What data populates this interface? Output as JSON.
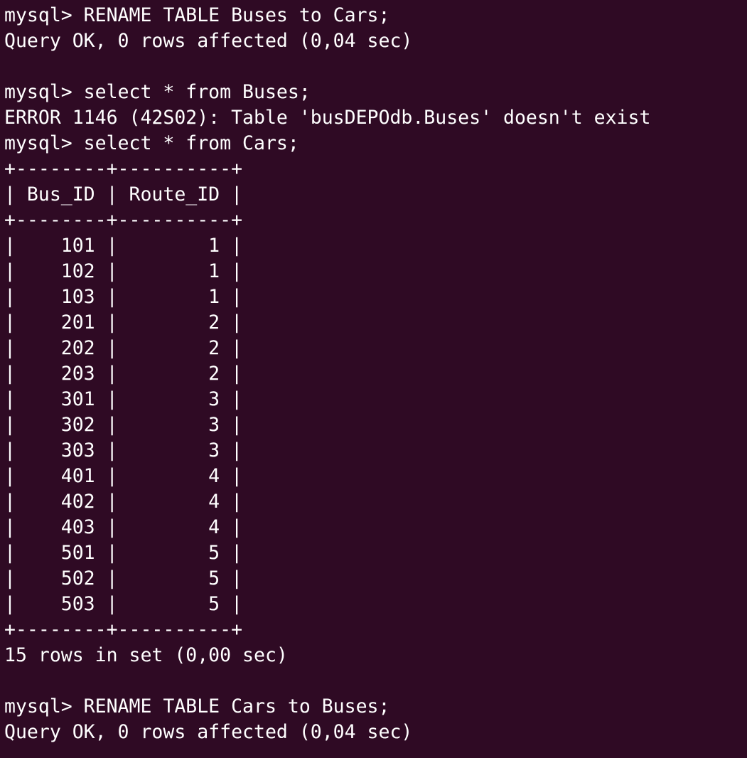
{
  "terminal": {
    "background": "#2f0a24",
    "foreground": "#ffffff",
    "lines": [
      "mysql> RENAME TABLE Buses to Cars;",
      "Query OK, 0 rows affected (0,04 sec)",
      "",
      "mysql> select * from Buses;",
      "ERROR 1146 (42S02): Table 'busDEPOdb.Buses' doesn't exist",
      "mysql> select * from Cars;",
      "+--------+----------+",
      "| Bus_ID | Route_ID |",
      "+--------+----------+",
      "|    101 |        1 |",
      "|    102 |        1 |",
      "|    103 |        1 |",
      "|    201 |        2 |",
      "|    202 |        2 |",
      "|    203 |        2 |",
      "|    301 |        3 |",
      "|    302 |        3 |",
      "|    303 |        3 |",
      "|    401 |        4 |",
      "|    402 |        4 |",
      "|    403 |        4 |",
      "|    501 |        5 |",
      "|    502 |        5 |",
      "|    503 |        5 |",
      "+--------+----------+",
      "15 rows in set (0,00 sec)",
      "",
      "mysql> RENAME TABLE Cars to Buses;",
      "Query OK, 0 rows affected (0,04 sec)"
    ]
  }
}
